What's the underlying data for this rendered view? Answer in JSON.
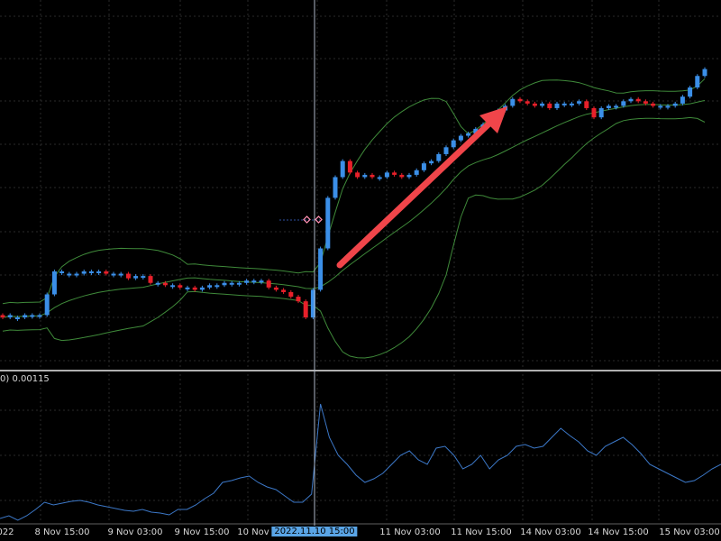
{
  "indicator": {
    "label": "0) 0.00115"
  },
  "time_axis": {
    "labels": [
      "022",
      "8 Nov 15:00",
      "9 Nov 03:00",
      "9 Nov 15:00",
      "10 Nov 03:00",
      "11 Nov 03:00",
      "11 Nov 15:00",
      "14 Nov 03:00",
      "14 Nov 15:00",
      "15 Nov 03:00"
    ],
    "cursor_label": "2022.11.10 15:00"
  },
  "colors": {
    "background": "#000000",
    "grid": "#2a2a2a",
    "up_candle": "#3b8fe8",
    "down_candle": "#e8202a",
    "band": "#3f8a3a",
    "indicator_line": "#3c78c8",
    "crosshair": "#aeb8c8",
    "arrow": "#f0454a",
    "separator": "#b0b0b0"
  },
  "chart_data": {
    "type": "candlestick",
    "annotations": [
      "red arrow pointing up-right"
    ],
    "candles": {
      "close": [
        0,
        1,
        0,
        1,
        1,
        1,
        10,
        20,
        20,
        19,
        19,
        20,
        20,
        20,
        19,
        19,
        19,
        17,
        18,
        18,
        15,
        15,
        14,
        14,
        13,
        13,
        12,
        13,
        14,
        14,
        15,
        15,
        15,
        16,
        16,
        16,
        13,
        12,
        11,
        9,
        7,
        0,
        12,
        30,
        52,
        61,
        68,
        63,
        61,
        62,
        61,
        61,
        63,
        62,
        61,
        62,
        64,
        67,
        68,
        71,
        74,
        77,
        79,
        80,
        82,
        84,
        87,
        90,
        92,
        95,
        94,
        93,
        92,
        93,
        91,
        93,
        93,
        93,
        94,
        91,
        87,
        91,
        92,
        92,
        94,
        95,
        94,
        93,
        92,
        92,
        92,
        93,
        96,
        100,
        105,
        108
      ],
      "open": [
        1,
        0,
        0,
        0,
        1,
        1,
        1,
        10,
        20,
        19,
        19,
        19,
        20,
        20,
        20,
        19,
        19,
        19,
        17,
        18,
        18,
        15,
        15,
        14,
        14,
        13,
        13,
        12,
        13,
        14,
        14,
        15,
        15,
        15,
        16,
        16,
        16,
        13,
        12,
        11,
        9,
        7,
        0,
        12,
        30,
        52,
        61,
        68,
        63,
        61,
        62,
        61,
        61,
        63,
        62,
        61,
        62,
        64,
        67,
        68,
        71,
        74,
        77,
        79,
        80,
        82,
        84,
        87,
        90,
        92,
        95,
        94,
        93,
        92,
        93,
        91,
        93,
        93,
        93,
        94,
        91,
        87,
        91,
        92,
        92,
        94,
        95,
        94,
        93,
        92,
        92,
        92,
        93,
        96,
        100,
        105
      ]
    }
  }
}
